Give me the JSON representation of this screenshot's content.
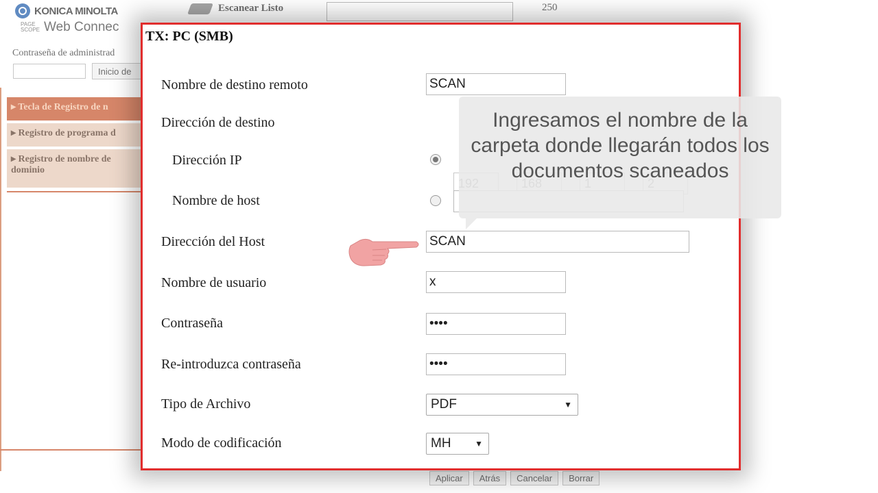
{
  "background": {
    "brand": "KONICA MINOLTA",
    "product": "Web Connec",
    "product_badge": "PAGE SCOPE",
    "scan_status": "Escanear Listo",
    "count": "250",
    "admin_password_label": "Contraseña de administrad",
    "login_button": "Inicio de",
    "nav": [
      {
        "label": "Tecla de Registro de n"
      },
      {
        "label": "Registro de programa d"
      },
      {
        "label": "Registro de nombre de dominio"
      }
    ],
    "bottom_buttons": [
      "Aplicar",
      "Atrás",
      "Cancelar",
      "Borrar"
    ]
  },
  "modal": {
    "title": "TX: PC (SMB)",
    "remote_dest_label": "Nombre de destino remoto",
    "remote_dest_value": "SCAN",
    "dest_address_label": "Dirección de destino",
    "ip_label": "Dirección IP",
    "ip": [
      "192",
      "168",
      "1",
      "2"
    ],
    "ip_selected": true,
    "host_name_label": "Nombre de host",
    "host_address_label": "Dirección del Host",
    "host_address_value": "SCAN",
    "username_label": "Nombre de usuario",
    "username_value": "x",
    "password_label": "Contraseña",
    "password_value": "••••",
    "repassword_label": "Re-introduzca contraseña",
    "repassword_value": "••••",
    "file_type_label": "Tipo de Archivo",
    "file_type_value": "PDF",
    "encoding_label": "Modo de codificación",
    "encoding_value": "MH"
  },
  "callout": {
    "text": "Ingresamos el nombre de la carpeta donde llegarán todos los documentos scaneados"
  },
  "colors": {
    "modal_border": "#e12d2d",
    "nav_active": "#c0461a",
    "nav_inactive": "#e4c4ae",
    "pointer_hand": "#f1a3a3"
  },
  "icons": {
    "logo": "konica-minolta-logo",
    "scanner": "scanner-icon",
    "pointer": "pointing-hand-icon"
  }
}
